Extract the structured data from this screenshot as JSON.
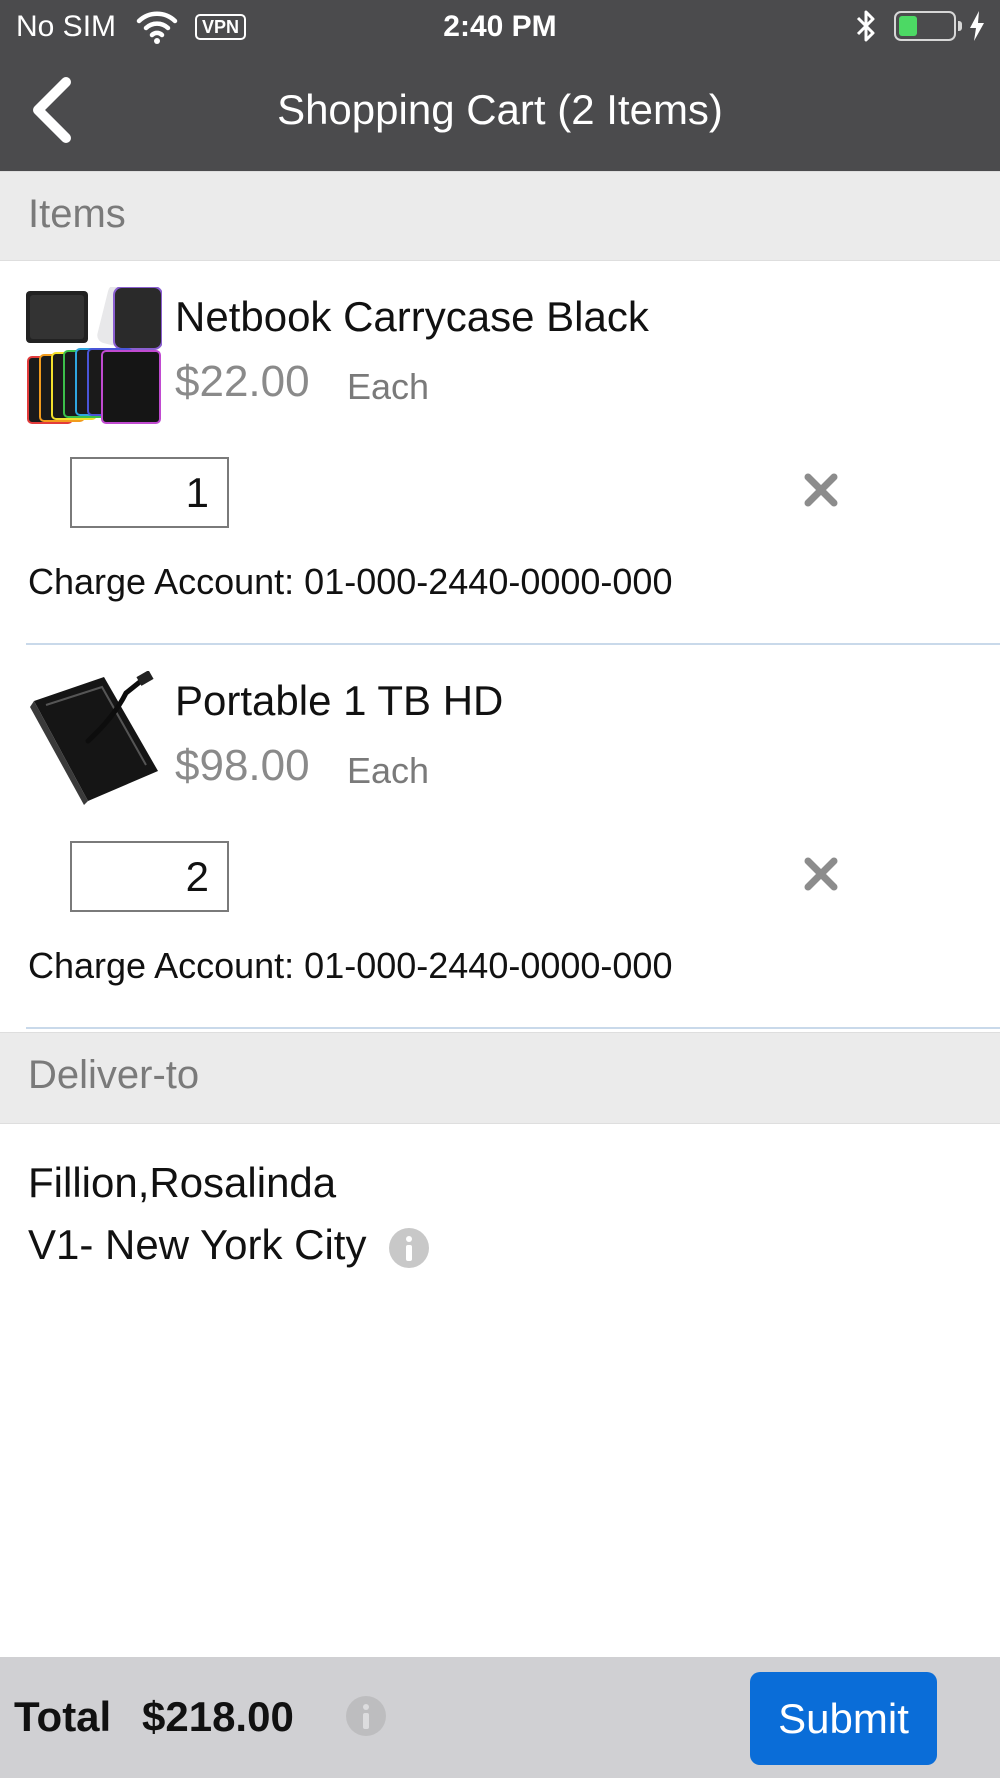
{
  "status_bar": {
    "carrier": "No SIM",
    "vpn": "VPN",
    "time": "2:40 PM",
    "battery_level": 0.35
  },
  "nav": {
    "title": "Shopping Cart (2 Items)"
  },
  "items_section": {
    "header": "Items"
  },
  "items": [
    {
      "name": "Netbook Carrycase Black",
      "price": "$22.00",
      "unit": "Each",
      "quantity": "1",
      "account": "Charge Account: 01-000-2440-0000-000"
    },
    {
      "name": "Portable 1 TB HD",
      "price": "$98.00",
      "unit": "Each",
      "quantity": "2",
      "account": "Charge Account: 01-000-2440-0000-000"
    }
  ],
  "deliver_section": {
    "header": "Deliver-to",
    "name": "Fillion,Rosalinda",
    "location": "V1- New York City"
  },
  "footer": {
    "total_label": "Total",
    "total_value": "$218.00",
    "submit_label": "Submit"
  },
  "colors": {
    "nav_bg": "#4b4b4d",
    "section_bg": "#ebebeb",
    "footer_bg": "#d0d0d3",
    "submit_bg": "#0a6dd8",
    "price_gray": "#8a8a8a",
    "divider": "#c9d9ea"
  },
  "icons": {
    "back": "chevron-left-icon",
    "remove": "close-icon",
    "info": "info-icon",
    "wifi": "wifi-icon",
    "bluetooth": "bluetooth-icon",
    "charging": "bolt-icon"
  }
}
